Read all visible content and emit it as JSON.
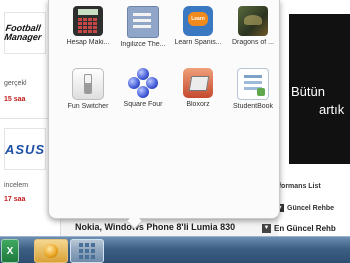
{
  "left_column": {
    "items": [
      {
        "logo": "Football Manager",
        "snippet": "gerçekl",
        "age": "15 saa"
      },
      {
        "logo": "ASUS",
        "snippet": "incelem",
        "age": "17 saa"
      }
    ]
  },
  "right_column": {
    "banner_line1": "Bütün",
    "banner_line2": "artık",
    "links": [
      "rformans List",
      "Güncel Rehbe"
    ],
    "bottom_link": "En Güncel Rehb"
  },
  "article": {
    "title": "Nokia, Windows Phone 8'li Lumia 830"
  },
  "app_menu": {
    "apps": [
      {
        "label": "Hesap Maki...",
        "icon": "calculator-icon"
      },
      {
        "label": "İngilizce The...",
        "icon": "dictionary-icon"
      },
      {
        "label": "Learn Spanis...",
        "icon": "learn-spanish-icon"
      },
      {
        "label": "Dragons of ...",
        "icon": "dragon-game-icon"
      },
      {
        "label": "Fun Switcher",
        "icon": "switch-icon"
      },
      {
        "label": "Square Four",
        "icon": "square-four-icon"
      },
      {
        "label": "Bloxorz",
        "icon": "bloxorz-icon"
      },
      {
        "label": "StudentBook",
        "icon": "studentbook-icon"
      }
    ]
  },
  "taskbar": {
    "excel_label": "X",
    "items": [
      "excel-icon",
      "app-icon",
      "app-grid-icon"
    ]
  }
}
